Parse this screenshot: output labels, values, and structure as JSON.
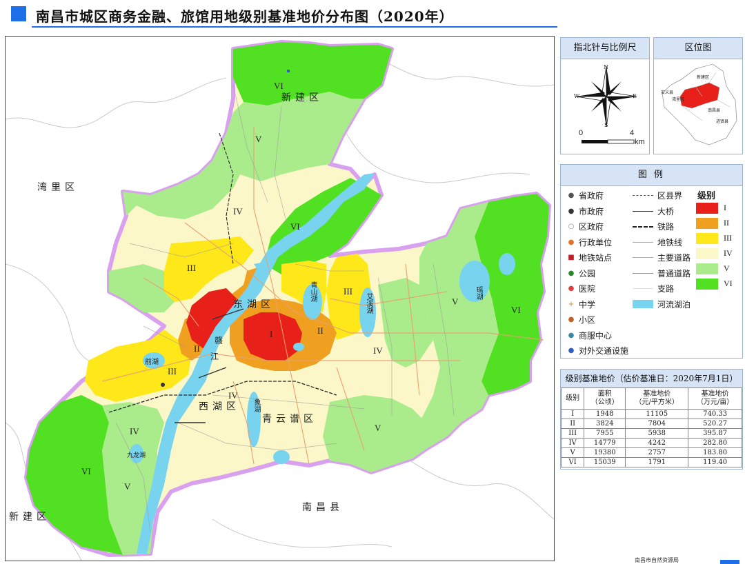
{
  "title": "南昌市城区商务金融、旅馆用地级别基准地价分布图（2020年）",
  "map": {
    "surrounding_labels": {
      "wanli": "湾里区",
      "xinjian_top": "新建区",
      "xinjian_bottom": "新建区",
      "nanchang_xian": "南昌县"
    },
    "district_labels": {
      "donghu": "东湖区",
      "xihu": "西湖区",
      "qingyunpu": "青云谱区"
    },
    "water_labels": {
      "gan": "赣",
      "jiang": "江",
      "qingshan": "青山湖",
      "aixi": "艾溪湖",
      "yaohu": "瑶湖",
      "xiangjiang": "象湖",
      "qianhu": "前湖",
      "jiulong": "九龙湖"
    },
    "grade_labels": [
      "VI",
      "V",
      "IV",
      "VI",
      "III",
      "I",
      "II",
      "II",
      "III",
      "III",
      "IV",
      "V",
      "VI",
      "IV",
      "IV",
      "V",
      "VI",
      "V",
      "III",
      "II"
    ],
    "colors": {
      "I": "#e8201a",
      "II": "#f0a020",
      "III": "#ffe81a",
      "IV": "#fbf7c8",
      "V": "#aaeb8c",
      "VI": "#52e022",
      "water": "#77d3ee",
      "boundary": "#d8a0ee"
    }
  },
  "compass_panel": {
    "title": "指北针与比例尺",
    "n": "N",
    "s": "S",
    "e": "E",
    "w": "W",
    "scale_start": "0",
    "scale_end": "4",
    "scale_unit": "km"
  },
  "location_panel": {
    "title": "区位图",
    "labels": [
      "新建区",
      "安义县",
      "湾里区",
      "南昌县",
      "进贤县"
    ]
  },
  "legend": {
    "title": "图 例",
    "points": [
      {
        "sym": "●",
        "color": "#555555",
        "label": "省政府"
      },
      {
        "sym": "●",
        "color": "#333333",
        "label": "市政府"
      },
      {
        "sym": "○",
        "color": "#888888",
        "label": "区政府"
      },
      {
        "sym": "●",
        "color": "#e0702a",
        "label": "行政单位"
      },
      {
        "sym": "■",
        "color": "#c0202a",
        "label": "地铁站点"
      },
      {
        "sym": "●",
        "color": "#2a8a2a",
        "label": "公园"
      },
      {
        "sym": "●",
        "color": "#e04040",
        "label": "医院"
      },
      {
        "sym": "+",
        "color": "#d08030",
        "label": "中学"
      },
      {
        "sym": "●",
        "color": "#c06028",
        "label": "小区"
      },
      {
        "sym": "●",
        "color": "#3a8aa8",
        "label": "商服中心"
      },
      {
        "sym": "●",
        "color": "#3060c0",
        "label": "对外交通设施"
      }
    ],
    "lines": [
      {
        "label": "区县界",
        "style": "dashed",
        "color": "#555555"
      },
      {
        "label": "大桥",
        "style": "solid",
        "color": "#333333"
      },
      {
        "label": "铁路",
        "style": "railway",
        "color": "#222222"
      },
      {
        "label": "地铁线",
        "style": "solid",
        "color": "#8acb6a"
      },
      {
        "label": "主要道路",
        "style": "solid",
        "color": "#e8a070"
      },
      {
        "label": "普通道路",
        "style": "solid",
        "color": "#999999"
      },
      {
        "label": "支路",
        "style": "solid",
        "color": "#dddddd"
      },
      {
        "label": "河流湖泊",
        "style": "water",
        "color": "#77d3ee"
      }
    ],
    "grade_title": "级别",
    "grades": [
      {
        "label": "I",
        "color": "#e8201a"
      },
      {
        "label": "II",
        "color": "#f0a020"
      },
      {
        "label": "III",
        "color": "#ffe81a"
      },
      {
        "label": "IV",
        "color": "#fbf7c8"
      },
      {
        "label": "V",
        "color": "#aaeb8c"
      },
      {
        "label": "VI",
        "color": "#52e022"
      }
    ]
  },
  "price_table": {
    "title": "级别基准地价（估价基准日：2020年7月1日）",
    "headers": [
      "级别",
      "面积\n（公顷）",
      "基准地价\n（元/平方米）",
      "基准地价\n（万元/亩）"
    ],
    "rows": [
      [
        "I",
        "1948",
        "11105",
        "740.33"
      ],
      [
        "II",
        "3824",
        "7804",
        "520.27"
      ],
      [
        "III",
        "7955",
        "5938",
        "395.87"
      ],
      [
        "IV",
        "14779",
        "4242",
        "282.80"
      ],
      [
        "V",
        "19380",
        "2757",
        "183.80"
      ],
      [
        "VI",
        "15039",
        "1791",
        "119.40"
      ]
    ]
  },
  "footer": "南昌市自然资源局"
}
